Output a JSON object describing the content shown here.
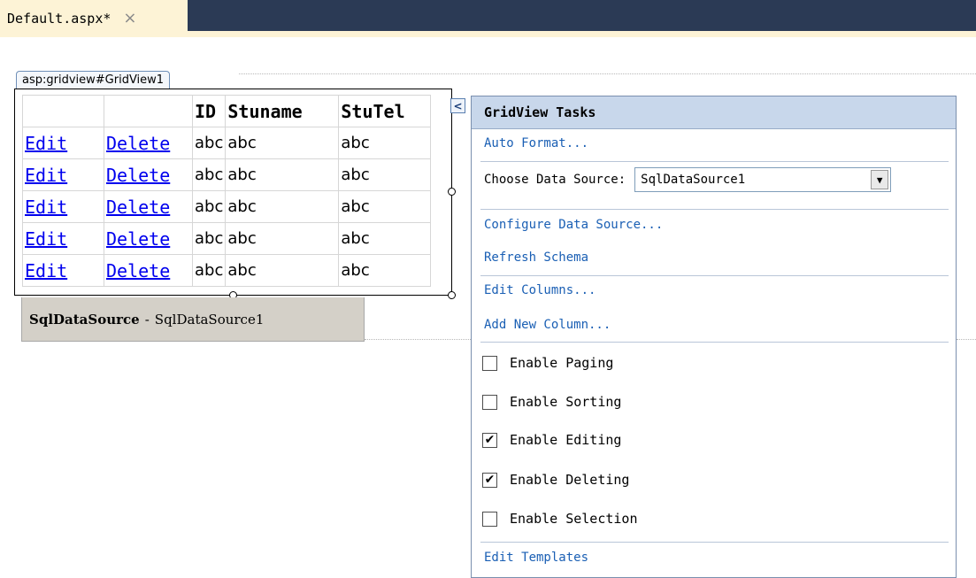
{
  "tab": {
    "title": "Default.aspx*",
    "close_icon": "×"
  },
  "control_tag": "asp:gridview#GridView1",
  "grid": {
    "headers": [
      "",
      "",
      "ID",
      "Stuname",
      "StuTel"
    ],
    "rows": [
      [
        "Edit",
        "Delete",
        "abc",
        "abc",
        "abc"
      ],
      [
        "Edit",
        "Delete",
        "abc",
        "abc",
        "abc"
      ],
      [
        "Edit",
        "Delete",
        "abc",
        "abc",
        "abc"
      ],
      [
        "Edit",
        "Delete",
        "abc",
        "abc",
        "abc"
      ],
      [
        "Edit",
        "Delete",
        "abc",
        "abc",
        "abc"
      ]
    ]
  },
  "smart_tag_glyph": "<",
  "sqldatasource": {
    "type": "SqlDataSource",
    "separator": "-",
    "name": "SqlDataSource1"
  },
  "tasks": {
    "title": "GridView Tasks",
    "auto_format": "Auto Format...",
    "choose_label": "Choose Data Source:",
    "choose_value": "SqlDataSource1",
    "dropdown_arrow": "▼",
    "configure": "Configure Data Source...",
    "refresh": "Refresh Schema",
    "edit_columns": "Edit Columns...",
    "add_column": "Add New Column...",
    "checkboxes": [
      {
        "label": "Enable Paging",
        "checked": false
      },
      {
        "label": "Enable Sorting",
        "checked": false
      },
      {
        "label": "Enable Editing",
        "checked": true
      },
      {
        "label": "Enable Deleting",
        "checked": true
      },
      {
        "label": "Enable Selection",
        "checked": false
      }
    ],
    "edit_templates": "Edit Templates"
  },
  "colors": {
    "link": "#0000ee",
    "task_link": "#1a5fb4",
    "tab_bar_dark": "#2b3a55",
    "tasks_header_bg": "#c8d7eb"
  }
}
